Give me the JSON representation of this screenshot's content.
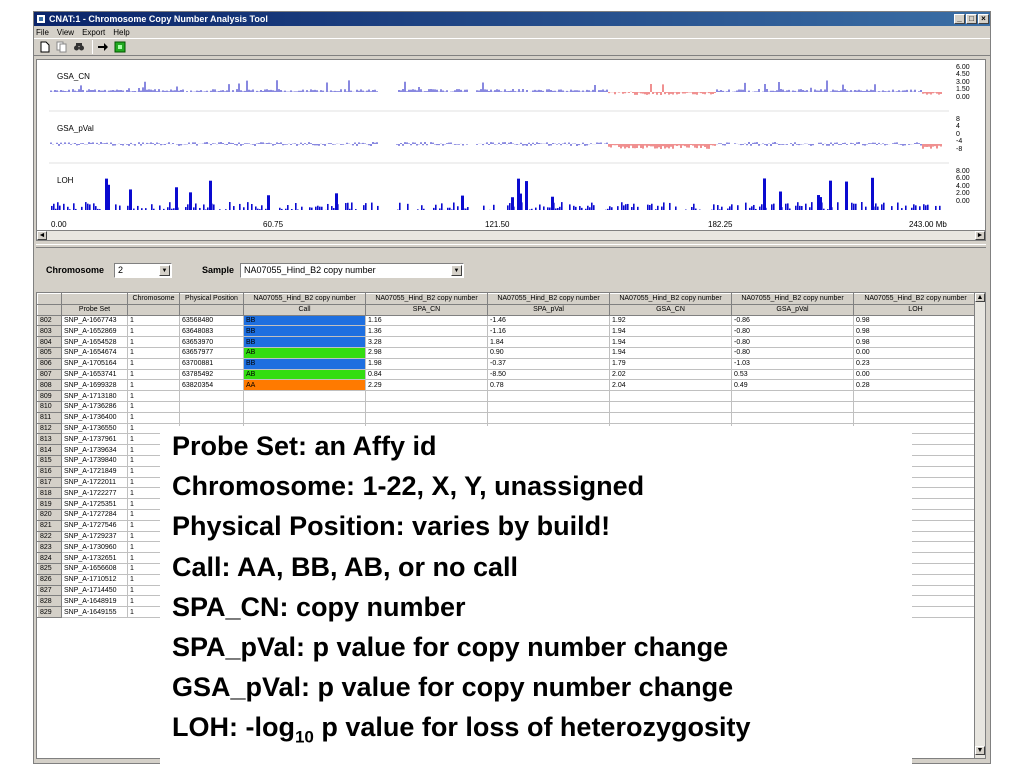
{
  "window": {
    "title": "CNAT:1 - Chromosome Copy Number Analysis Tool",
    "controls": [
      "_",
      "□",
      "×"
    ]
  },
  "menu": [
    "File",
    "View",
    "Export",
    "Help"
  ],
  "toolbar": {
    "icons": [
      "new-icon",
      "copy-icon",
      "find-icon",
      "arrow-icon",
      "run-icon"
    ]
  },
  "plots": {
    "gsa_cn": {
      "label": "GSA_CN",
      "ticks": [
        "6.00",
        "4.50",
        "3.00",
        "1.50",
        "0.00"
      ]
    },
    "gsa_pval": {
      "label": "GSA_pVal",
      "ticks": [
        "8",
        "4",
        "0",
        "-4",
        "-8"
      ]
    },
    "loh": {
      "label": "LOH",
      "ticks": [
        "8.00",
        "6.00",
        "4.00",
        "2.00",
        "0.00"
      ]
    },
    "xaxis": [
      "0.00",
      "60.75",
      "121.50",
      "182.25",
      "243.00 Mb"
    ]
  },
  "selectors": {
    "chromosome_label": "Chromosome",
    "chromosome_value": "2",
    "sample_label": "Sample",
    "sample_value": "NA07055_Hind_B2 copy number"
  },
  "table": {
    "header1": [
      "",
      "Chromosome",
      "Physical Position",
      "NA07055_Hind_B2 copy number",
      "NA07055_Hind_B2 copy number",
      "NA07055_Hind_B2 copy number",
      "NA07055_Hind_B2 copy number",
      "NA07055_Hind_B2 copy number",
      "NA07055_Hind_B2 copy number"
    ],
    "header2": [
      "Probe Set",
      "",
      "",
      "Call",
      "SPA_CN",
      "SPA_pVal",
      "GSA_CN",
      "GSA_pVal",
      "LOH"
    ],
    "call_colors": {
      "BB": "#1e6fe0",
      "AB": "#33dd11",
      "AA": "#ff7a00"
    },
    "rows": [
      [
        "802",
        "SNP_A-1667743",
        "1",
        "63568480",
        "BB",
        "1.16",
        "-1.46",
        "1.92",
        "-0.86",
        "0.98"
      ],
      [
        "803",
        "SNP_A-1652869",
        "1",
        "63648083",
        "BB",
        "1.36",
        "-1.16",
        "1.94",
        "-0.80",
        "0.98"
      ],
      [
        "804",
        "SNP_A-1654528",
        "1",
        "63653970",
        "BB",
        "3.28",
        "1.84",
        "1.94",
        "-0.80",
        "0.98"
      ],
      [
        "805",
        "SNP_A-1654674",
        "1",
        "63657977",
        "AB",
        "2.98",
        "0.90",
        "1.94",
        "-0.80",
        "0.00"
      ],
      [
        "806",
        "SNP_A-1705164",
        "1",
        "63700881",
        "BB",
        "1.98",
        "-0.37",
        "1.79",
        "-1.03",
        "0.23"
      ],
      [
        "807",
        "SNP_A-1653741",
        "1",
        "63785492",
        "AB",
        "0.84",
        "-8.50",
        "2.02",
        "0.53",
        "0.00"
      ],
      [
        "808",
        "SNP_A-1699328",
        "1",
        "63820354",
        "AA",
        "2.29",
        "0.78",
        "2.04",
        "0.49",
        "0.28"
      ],
      [
        "809",
        "SNP_A-1713180",
        "1",
        "",
        "",
        "",
        "",
        "",
        "",
        ""
      ],
      [
        "810",
        "SNP_A-1736286",
        "1",
        "",
        "",
        "",
        "",
        "",
        "",
        ""
      ],
      [
        "811",
        "SNP_A-1736400",
        "1",
        "",
        "",
        "",
        "",
        "",
        "",
        ""
      ],
      [
        "812",
        "SNP_A-1736550",
        "1",
        "",
        "",
        "",
        "",
        "",
        "",
        ""
      ],
      [
        "813",
        "SNP_A-1737961",
        "1",
        "",
        "",
        "",
        "",
        "",
        "",
        ""
      ],
      [
        "814",
        "SNP_A-1739634",
        "1",
        "",
        "",
        "",
        "",
        "",
        "",
        ""
      ],
      [
        "815",
        "SNP_A-1739840",
        "1",
        "",
        "",
        "",
        "",
        "",
        "",
        ""
      ],
      [
        "816",
        "SNP_A-1721849",
        "1",
        "",
        "",
        "",
        "",
        "",
        "",
        ""
      ],
      [
        "817",
        "SNP_A-1722011",
        "1",
        "",
        "",
        "",
        "",
        "",
        "",
        ""
      ],
      [
        "818",
        "SNP_A-1722277",
        "1",
        "",
        "",
        "",
        "",
        "",
        "",
        ""
      ],
      [
        "819",
        "SNP_A-1725351",
        "1",
        "",
        "",
        "",
        "",
        "",
        "",
        ""
      ],
      [
        "820",
        "SNP_A-1727284",
        "1",
        "",
        "",
        "",
        "",
        "",
        "",
        ""
      ],
      [
        "821",
        "SNP_A-1727546",
        "1",
        "",
        "",
        "",
        "",
        "",
        "",
        ""
      ],
      [
        "822",
        "SNP_A-1729237",
        "1",
        "",
        "",
        "",
        "",
        "",
        "",
        ""
      ],
      [
        "823",
        "SNP_A-1730960",
        "1",
        "",
        "",
        "",
        "",
        "",
        "",
        ""
      ],
      [
        "824",
        "SNP_A-1732651",
        "1",
        "",
        "",
        "",
        "",
        "",
        "",
        ""
      ],
      [
        "825",
        "SNP_A-1656608",
        "1",
        "",
        "",
        "",
        "",
        "",
        "",
        ""
      ],
      [
        "826",
        "SNP_A-1710512",
        "1",
        "",
        "",
        "",
        "",
        "",
        "",
        ""
      ],
      [
        "827",
        "SNP_A-1714450",
        "1",
        "",
        "",
        "",
        "",
        "",
        "",
        ""
      ],
      [
        "828",
        "SNP_A-1648919",
        "1",
        "",
        "",
        "",
        "",
        "",
        "",
        ""
      ],
      [
        "829",
        "SNP_A-1649155",
        "1",
        "",
        "",
        "",
        "",
        "",
        "",
        ""
      ]
    ]
  },
  "overlay": {
    "line1": "Probe Set: an Affy id",
    "line2": "Chromosome: 1-22, X, Y, unassigned",
    "line3": "Physical Position: varies by build!",
    "line4": "Call: AA, BB, AB, or no call",
    "line5": "SPA_CN: copy number",
    "line6": "SPA_pVal: p value for copy number change",
    "line7": "GSA_pVal: p value for copy number change",
    "line8_pre": "LOH: -log",
    "line8_sub": "10",
    "line8_post": " p value for loss of heterozygosity"
  }
}
